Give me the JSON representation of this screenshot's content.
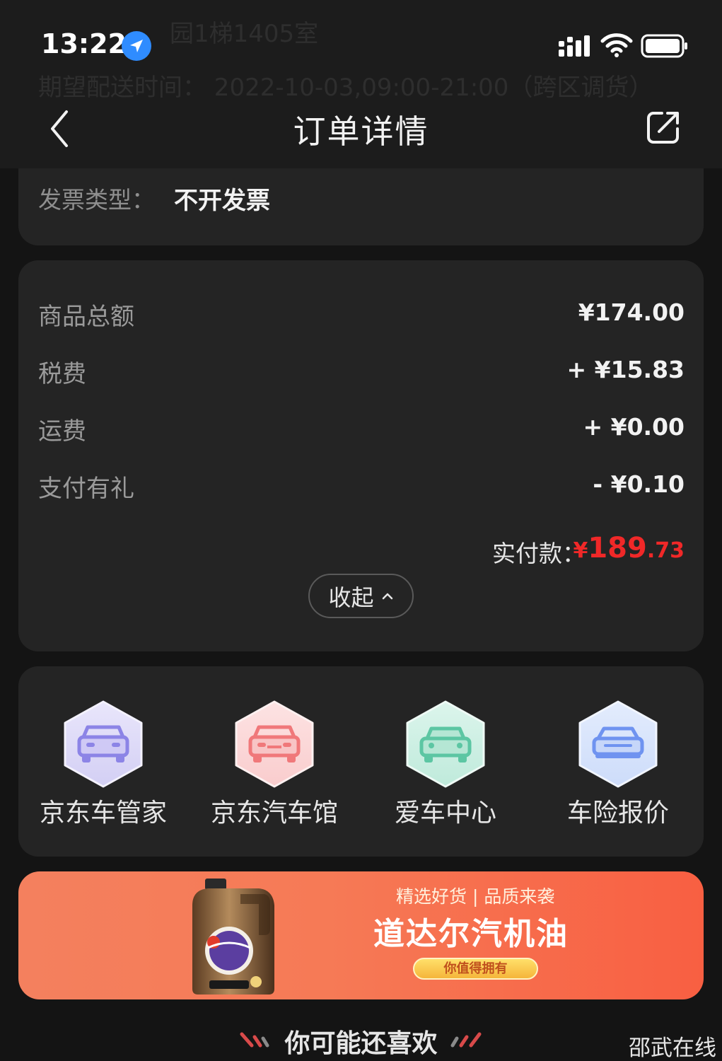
{
  "status_bar": {
    "time": "13:22",
    "icons": [
      "location-icon",
      "signal-icon",
      "wifi-icon",
      "battery-icon"
    ]
  },
  "background_ghost": {
    "line1": "园1梯1405室",
    "line2": "期望配送时间： 2022-10-03,09:00-21:00（跨区调货）"
  },
  "nav": {
    "title": "订单详情",
    "back_icon": "chevron-left-icon",
    "share_icon": "share-icon"
  },
  "invoice": {
    "label": "发票类型：",
    "value": "不开发票"
  },
  "summary": {
    "rows": [
      {
        "label": "商品总额",
        "value": "¥174.00"
      },
      {
        "label": "税费",
        "value": "+ ¥15.83"
      },
      {
        "label": "运费",
        "value": "+ ¥0.00"
      },
      {
        "label": "支付有礼",
        "value": "- ¥0.10"
      }
    ],
    "paid_label": "实付款：",
    "paid_currency": "¥",
    "paid_integer": "189",
    "paid_decimal": ".73",
    "collapse_label": "收起",
    "accent_color": "#f02828"
  },
  "services": [
    {
      "label": "京东车管家",
      "icon": "car-icon",
      "color": "#8c84e6"
    },
    {
      "label": "京东汽车馆",
      "icon": "car-icon",
      "color": "#f0787a"
    },
    {
      "label": "爱车中心",
      "icon": "car-icon",
      "color": "#5cc6a3"
    },
    {
      "label": "车险报价",
      "icon": "car-shield-icon",
      "color": "#6f93f0"
    }
  ],
  "banner": {
    "subtitle": "精选好货 | 品质来袭",
    "title": "道达尔汽机油",
    "pill": "你值得拥有",
    "product_icon": "oil-can-icon"
  },
  "recommend_title": "你可能还喜欢",
  "watermark": "邵武在线"
}
